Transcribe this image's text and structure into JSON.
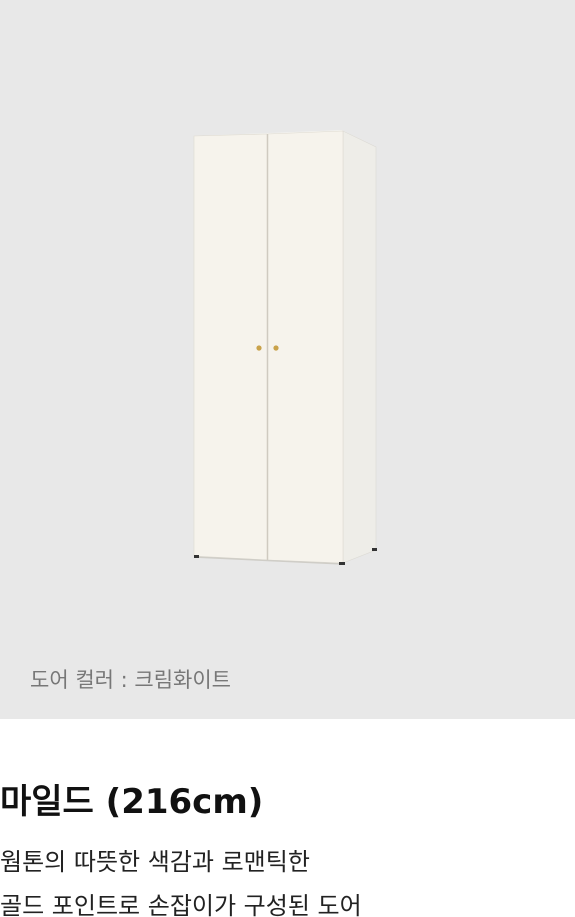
{
  "product": {
    "door_color_label": "도어 컬러 : 크림화이트",
    "title": "마일드 (216cm)",
    "description_lines": [
      "웜톤의 따뜻한 색감과 로맨틱한",
      "골드 포인트로 손잡이가 구성된 도어"
    ]
  },
  "colors": {
    "image_background": "#e8e8e8",
    "door": "#f6f3ec",
    "cabinet_side": "#f0efea",
    "handle": "#c9a24a"
  }
}
